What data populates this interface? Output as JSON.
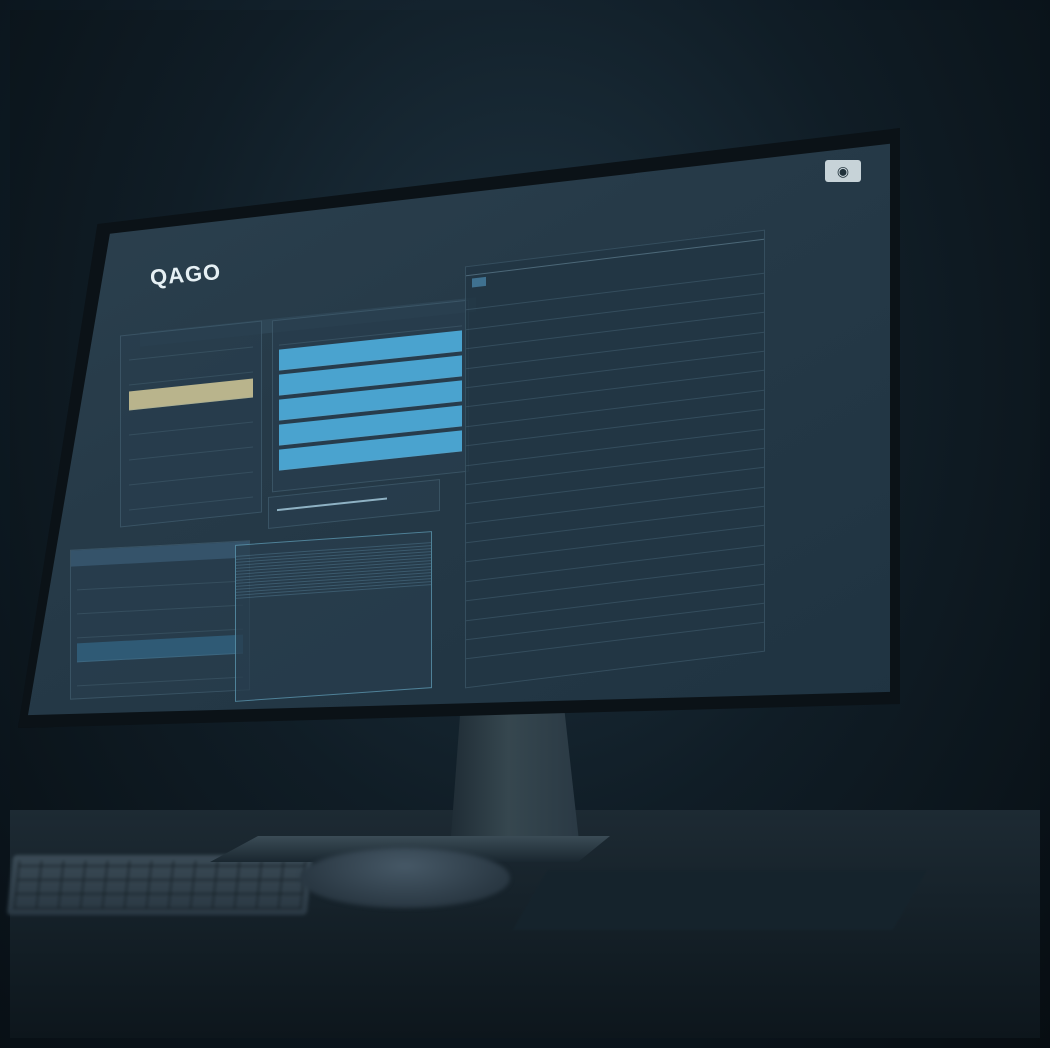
{
  "app": {
    "logo": "QAGO",
    "subtitle": "",
    "camera_icon": "camera-icon"
  },
  "search_bar": {
    "placeholder": "",
    "right_label": ""
  },
  "sidebar": {
    "items": [
      {
        "label": ""
      },
      {
        "label": ""
      },
      {
        "label": "",
        "active": true
      },
      {
        "label": ""
      },
      {
        "label": ""
      },
      {
        "label": ""
      },
      {
        "label": ""
      }
    ]
  },
  "mid_list": {
    "rows": [
      {
        "label": "",
        "value": "",
        "highlight": false
      },
      {
        "label": "",
        "value": "",
        "highlight": true
      },
      {
        "label": "",
        "value": "",
        "highlight": true
      },
      {
        "label": "",
        "value": "",
        "highlight": true
      },
      {
        "label": "",
        "value": "",
        "highlight": true
      },
      {
        "label": "",
        "value": "",
        "highlight": true
      }
    ]
  },
  "slider": {
    "label": "",
    "value": ""
  },
  "bottom_left": {
    "header": "",
    "items": [
      {
        "label": ""
      },
      {
        "label": ""
      },
      {
        "label": ""
      },
      {
        "label": "",
        "active": true
      },
      {
        "label": ""
      }
    ]
  },
  "log": {
    "title": "",
    "lines": [
      "",
      "",
      "",
      "",
      "",
      "",
      "",
      "",
      "",
      "",
      "",
      "",
      "",
      "",
      ""
    ]
  },
  "table": {
    "tabs": [],
    "sub_tabs": [],
    "rows": [
      {
        "id": "",
        "name": "",
        "value": ""
      },
      {
        "id": "",
        "name": "",
        "value": ""
      },
      {
        "id": "",
        "name": "",
        "value": ""
      },
      {
        "id": "",
        "name": "",
        "value": ""
      },
      {
        "id": "",
        "name": "",
        "value": ""
      },
      {
        "id": "",
        "name": "",
        "value": ""
      },
      {
        "id": "",
        "name": "",
        "value": ""
      },
      {
        "id": "",
        "name": "",
        "value": ""
      },
      {
        "id": "",
        "name": "",
        "value": ""
      },
      {
        "id": "",
        "name": "",
        "value": ""
      },
      {
        "id": "",
        "name": "",
        "value": ""
      },
      {
        "id": "",
        "name": "",
        "value": ""
      },
      {
        "id": "",
        "name": "",
        "value": ""
      },
      {
        "id": "",
        "name": "",
        "value": ""
      },
      {
        "id": "",
        "name": "",
        "value": ""
      },
      {
        "id": "",
        "name": "",
        "value": ""
      },
      {
        "id": "",
        "name": "",
        "value": ""
      },
      {
        "id": "",
        "name": "",
        "value": ""
      },
      {
        "id": "",
        "name": "",
        "value": ""
      }
    ]
  },
  "colors": {
    "accent_blue": "#4aa3cf",
    "active_nav": "#b9b48c",
    "screen_bg": "#263a48",
    "background": "#0d1922"
  }
}
